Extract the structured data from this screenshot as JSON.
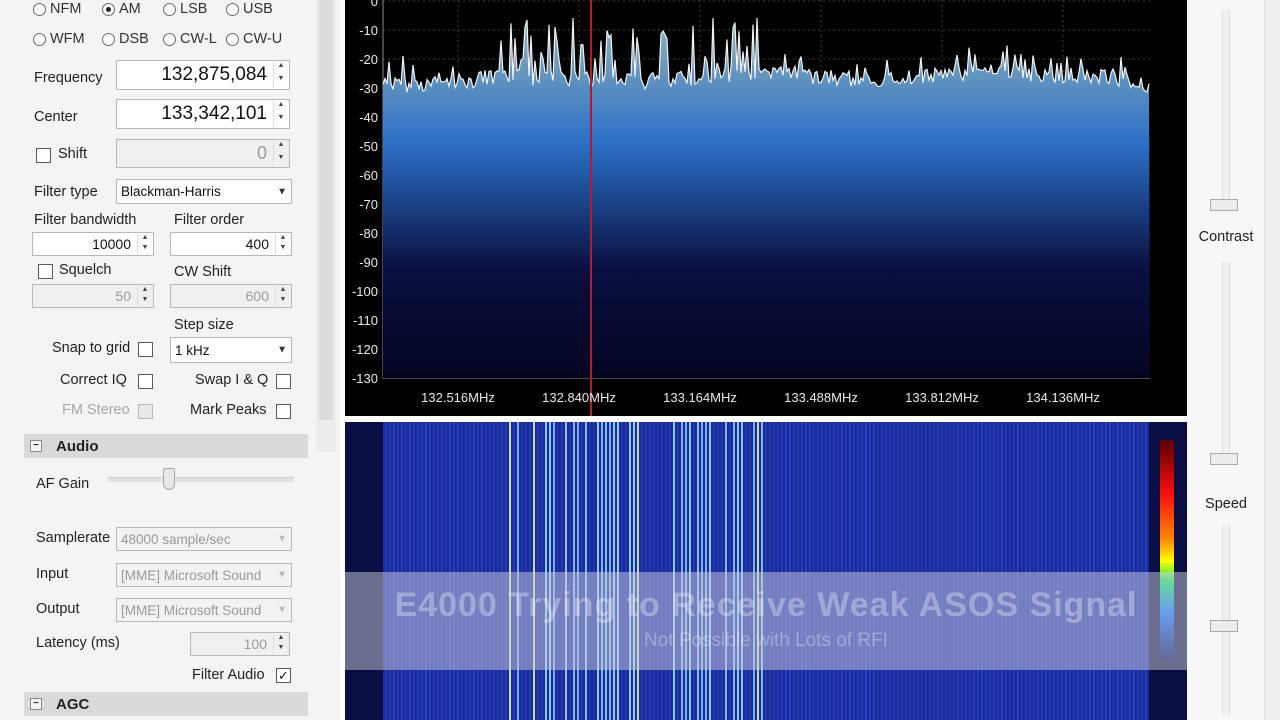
{
  "modes": {
    "row1": [
      {
        "label": "NFM",
        "selected": false
      },
      {
        "label": "AM",
        "selected": true
      },
      {
        "label": "LSB",
        "selected": false
      },
      {
        "label": "USB",
        "selected": false
      }
    ],
    "row2": [
      {
        "label": "WFM",
        "selected": false
      },
      {
        "label": "DSB",
        "selected": false
      },
      {
        "label": "CW-L",
        "selected": false
      },
      {
        "label": "CW-U",
        "selected": false
      }
    ]
  },
  "radio_tuning": {
    "frequency_label": "Frequency",
    "frequency_value": "132,875,084",
    "center_label": "Center",
    "center_value": "133,342,101",
    "shift_label": "Shift",
    "shift_value": "0",
    "filter_type_label": "Filter type",
    "filter_type_value": "Blackman-Harris",
    "filter_bandwidth_label": "Filter bandwidth",
    "filter_bandwidth_value": "10000",
    "filter_order_label": "Filter order",
    "filter_order_value": "400",
    "squelch_label": "Squelch",
    "squelch_value": "50",
    "cw_shift_label": "CW Shift",
    "cw_shift_value": "600",
    "step_size_label": "Step size",
    "step_size_value": "1 kHz",
    "snap_to_grid_label": "Snap to grid",
    "correct_iq_label": "Correct IQ",
    "swap_iq_label": "Swap I & Q",
    "fm_stereo_label": "FM Stereo",
    "mark_peaks_label": "Mark Peaks"
  },
  "audio": {
    "header": "Audio",
    "af_gain_label": "AF Gain",
    "af_gain_level": 0.33,
    "samplerate_label": "Samplerate",
    "samplerate_value": "48000 sample/sec",
    "input_label": "Input",
    "input_value": "[MME] Microsoft Sound",
    "output_label": "Output",
    "output_value": "[MME] Microsoft Sound",
    "latency_label": "Latency (ms)",
    "latency_value": "100",
    "filter_audio_label": "Filter Audio",
    "filter_audio_checked": true,
    "filter_audio_mark": "✓"
  },
  "agc": {
    "header": "AGC"
  },
  "display_controls": {
    "contrast_label": "Contrast",
    "speed_label": "Speed"
  },
  "spectrum": {
    "db_ticks": [
      "0",
      "-10",
      "-20",
      "-30",
      "-40",
      "-50",
      "-60",
      "-70",
      "-80",
      "-90",
      "-100",
      "-110",
      "-120",
      "-130"
    ],
    "freq_ticks": [
      "132.516MHz",
      "132.840MHz",
      "133.164MHz",
      "133.488MHz",
      "133.812MHz",
      "134.136MHz"
    ],
    "tuned_line_color": "#b02020",
    "trace_color": "#f2f2f2",
    "fill_top_color": "#8fb3b8",
    "fill_mid_color": "#2d6fc7",
    "fill_bottom_color": "#0a0f40"
  },
  "waterfall": {
    "background_color": "#0b0e45"
  },
  "overlay": {
    "title": "E4000 Trying to Receive Weak ASOS Signal",
    "subtitle": "Not Possible with Lots of RFI"
  },
  "icons": {
    "collapse": "minus-icon",
    "dropdown": "chevron-down-icon",
    "spin": "spin-arrows-icon"
  }
}
